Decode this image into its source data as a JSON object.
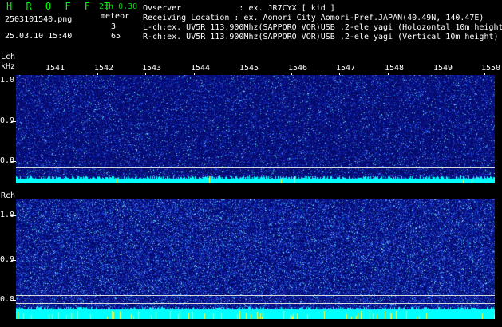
{
  "header": {
    "app_title": "H R O F F T",
    "version": "2ch 0.30",
    "filename": "2503101540.png",
    "meteor_label": "meteor",
    "datetime": "25.03.10 15:40",
    "count_lch": "3",
    "count_rch": "65",
    "observer_line": "Ovserver            : ex. JR7CYX [ kid ]",
    "location_line": "Receiving Location : ex. Aomori City Aomori-Pref.JAPAN(40.49N, 140.47E)",
    "lch_line": "L-ch:ex. UV5R 113.900Mhz(SAPPORO VOR)USB ,2-ele yagi (Holozontal 10m height)",
    "rch_line": "R-ch:ex. UV5R 113.900Mhz(SAPPORO VOR)USB ,2-ele yagi (Vertical 10m height)"
  },
  "lch_panel": {
    "label": "Lch",
    "unit": "kHz",
    "y_ticks": [
      "1.0",
      "0.9",
      "0.8"
    ]
  },
  "rch_panel": {
    "label": "Rch",
    "y_ticks": [
      "1.0",
      "0.9",
      "0.8"
    ]
  },
  "time_axis": [
    "1541",
    "1542",
    "1543",
    "1544",
    "1545",
    "1546",
    "1547",
    "1548",
    "1549",
    "1550"
  ],
  "colors": {
    "background": "#000000",
    "header_green": "#00e000",
    "spectrum_noise": "#0a1a90",
    "baseline_cyan": "#00ffff",
    "meteor_yellow": "#ffff00"
  }
}
